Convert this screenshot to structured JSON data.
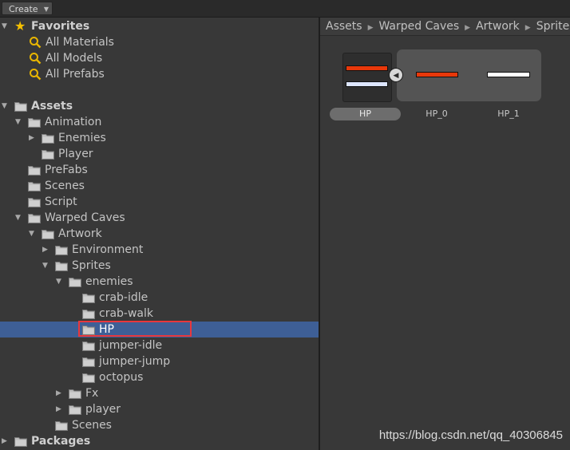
{
  "toolbar": {
    "create_label": "Create"
  },
  "tree": {
    "favorites_label": "Favorites",
    "favorites": [
      "All Materials",
      "All Models",
      "All Prefabs"
    ],
    "assets_label": "Assets",
    "items": [
      {
        "label": "Animation",
        "indent": 1,
        "arrow": "down"
      },
      {
        "label": "Enemies",
        "indent": 2,
        "arrow": "right"
      },
      {
        "label": "Player",
        "indent": 2,
        "arrow": "none"
      },
      {
        "label": "PreFabs",
        "indent": 1,
        "arrow": "none"
      },
      {
        "label": "Scenes",
        "indent": 1,
        "arrow": "none"
      },
      {
        "label": "Script",
        "indent": 1,
        "arrow": "none"
      },
      {
        "label": "Warped Caves",
        "indent": 1,
        "arrow": "down"
      },
      {
        "label": "Artwork",
        "indent": 2,
        "arrow": "down"
      },
      {
        "label": "Environment",
        "indent": 3,
        "arrow": "right"
      },
      {
        "label": "Sprites",
        "indent": 3,
        "arrow": "down"
      },
      {
        "label": "enemies",
        "indent": 4,
        "arrow": "down"
      },
      {
        "label": "crab-idle",
        "indent": 5,
        "arrow": "none"
      },
      {
        "label": "crab-walk",
        "indent": 5,
        "arrow": "none"
      },
      {
        "label": "HP",
        "indent": 5,
        "arrow": "none",
        "selected": true
      },
      {
        "label": "jumper-idle",
        "indent": 5,
        "arrow": "none"
      },
      {
        "label": "jumper-jump",
        "indent": 5,
        "arrow": "none"
      },
      {
        "label": "octopus",
        "indent": 5,
        "arrow": "none"
      },
      {
        "label": "Fx",
        "indent": 4,
        "arrow": "right"
      },
      {
        "label": "player",
        "indent": 4,
        "arrow": "right"
      },
      {
        "label": "Scenes",
        "indent": 3,
        "arrow": "none"
      }
    ],
    "packages_label": "Packages"
  },
  "breadcrumb": [
    "Assets",
    "Warped Caves",
    "Artwork",
    "Sprites"
  ],
  "assets": [
    {
      "label": "HP",
      "selected": true
    },
    {
      "label": "HP_0"
    },
    {
      "label": "HP_1"
    }
  ],
  "watermark": "https://blog.csdn.net/qq_40306845",
  "colors": {
    "selection": "#3e5f96",
    "highlight_box": "#e8373c",
    "hp_red": "#e8380a",
    "hp_white": "#ffffff",
    "hp_lightblue": "#dde6ff",
    "star": "#f5c000",
    "search_icon": "#e9b600"
  }
}
